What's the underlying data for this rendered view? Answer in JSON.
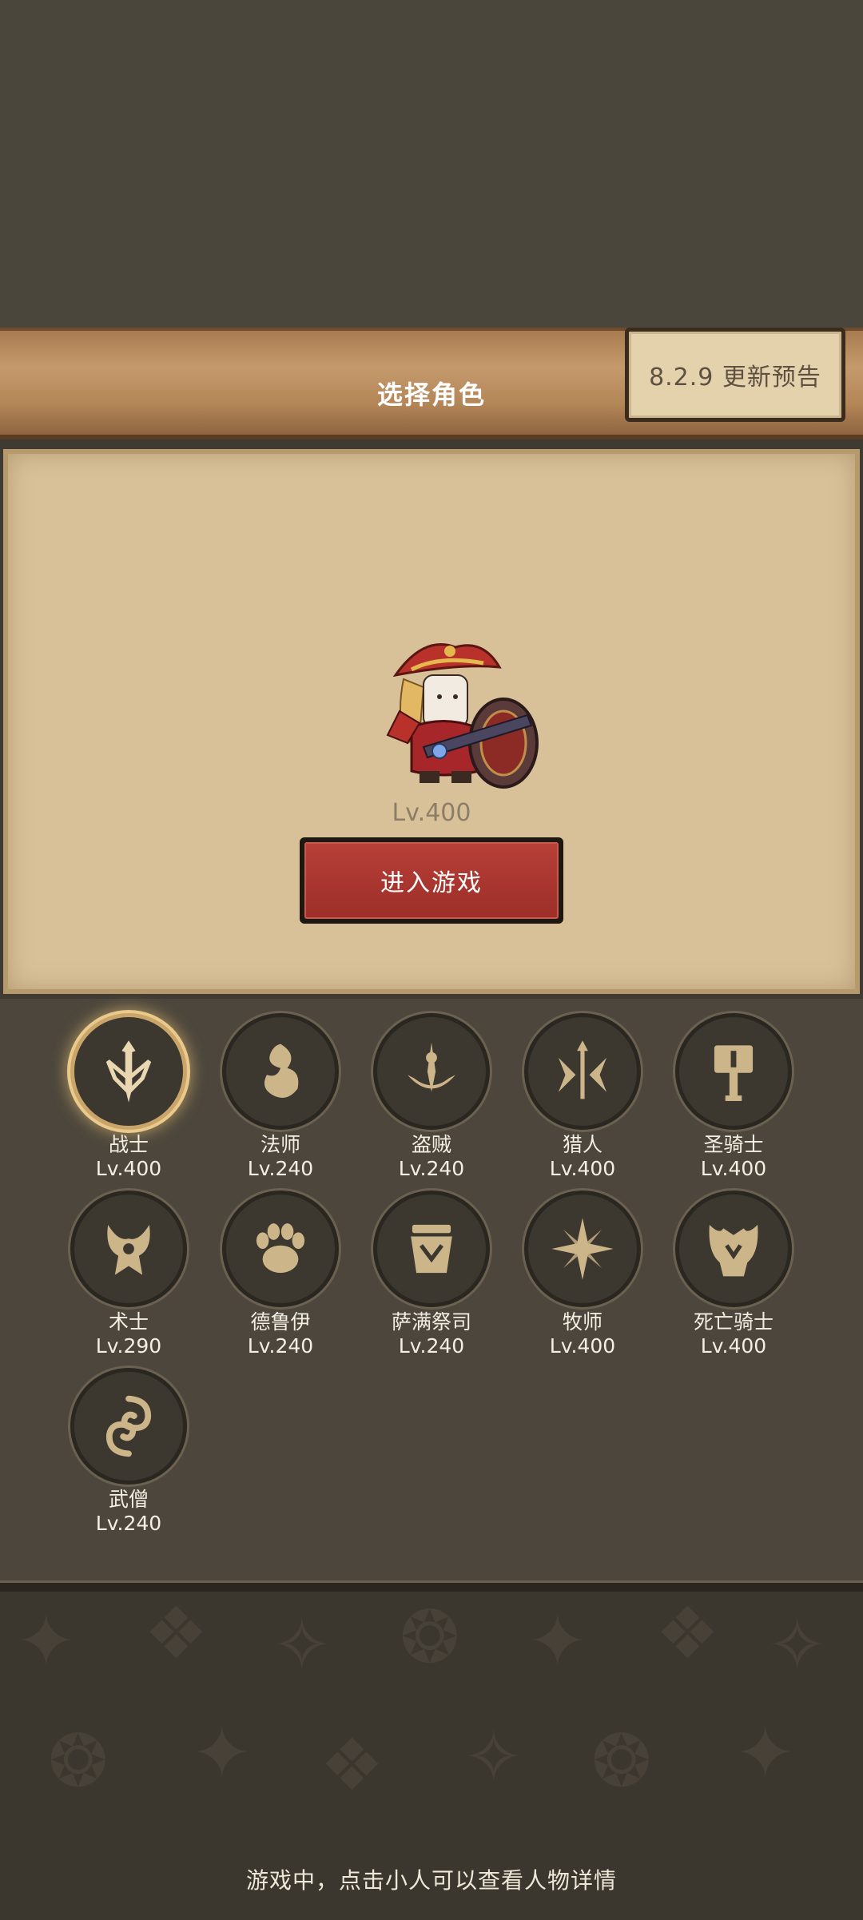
{
  "header": {
    "title": "选择角色",
    "update_button": "8.2.9 更新预告"
  },
  "selected_character": {
    "level": "Lv.400",
    "enter_button": "进入游戏"
  },
  "classes": [
    {
      "name": "战士",
      "level": "Lv.400",
      "icon": "warrior-icon",
      "selected": true
    },
    {
      "name": "法师",
      "level": "Lv.240",
      "icon": "mage-icon"
    },
    {
      "name": "盗贼",
      "level": "Lv.240",
      "icon": "rogue-icon"
    },
    {
      "name": "猎人",
      "level": "Lv.400",
      "icon": "hunter-icon"
    },
    {
      "name": "圣骑士",
      "level": "Lv.400",
      "icon": "paladin-icon"
    },
    {
      "name": "术士",
      "level": "Lv.290",
      "icon": "warlock-icon"
    },
    {
      "name": "德鲁伊",
      "level": "Lv.240",
      "icon": "druid-icon"
    },
    {
      "name": "萨满祭司",
      "level": "Lv.240",
      "icon": "shaman-icon"
    },
    {
      "name": "牧师",
      "level": "Lv.400",
      "icon": "priest-icon"
    },
    {
      "name": "死亡骑士",
      "level": "Lv.400",
      "icon": "death-knight-icon"
    },
    {
      "name": "武僧",
      "level": "Lv.240",
      "icon": "monk-icon"
    }
  ],
  "footer": {
    "hint": "游戏中，点击小人可以查看人物详情"
  },
  "colors": {
    "accent_red": "#b84038",
    "parchment": "#d8c199",
    "icon_gold": "#cdb58a"
  }
}
